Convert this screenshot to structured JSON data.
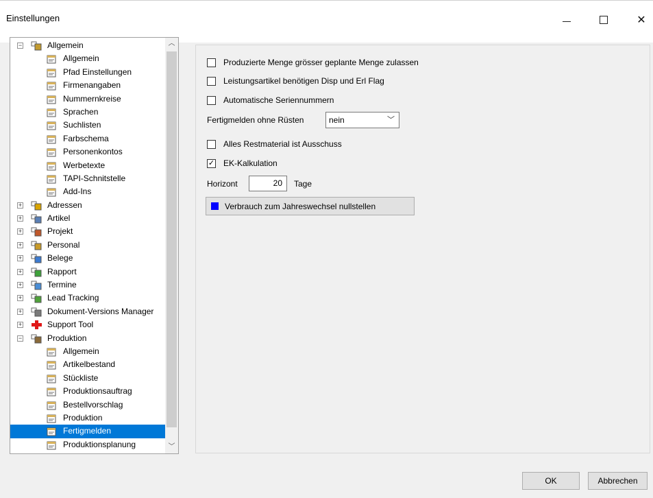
{
  "window": {
    "title": "Einstellungen",
    "minimize": "—",
    "close": "✕"
  },
  "tree": [
    {
      "label": "Allgemein",
      "level": 0,
      "expander": "−",
      "icon": "settings-folder-icon"
    },
    {
      "label": "Allgemein",
      "level": 1,
      "icon": "settings-page-icon"
    },
    {
      "label": "Pfad Einstellungen",
      "level": 1,
      "icon": "settings-page-icon"
    },
    {
      "label": "Firmenangaben",
      "level": 1,
      "icon": "settings-page-icon"
    },
    {
      "label": "Nummernkreise",
      "level": 1,
      "icon": "settings-page-icon"
    },
    {
      "label": "Sprachen",
      "level": 1,
      "icon": "settings-page-icon"
    },
    {
      "label": "Suchlisten",
      "level": 1,
      "icon": "settings-page-icon"
    },
    {
      "label": "Farbschema",
      "level": 1,
      "icon": "settings-page-icon"
    },
    {
      "label": "Personenkontos",
      "level": 1,
      "icon": "settings-page-icon"
    },
    {
      "label": "Werbetexte",
      "level": 1,
      "icon": "settings-page-icon"
    },
    {
      "label": "TAPI-Schnitstelle",
      "level": 1,
      "icon": "settings-page-icon"
    },
    {
      "label": "Add-Ins",
      "level": 1,
      "icon": "settings-page-icon"
    },
    {
      "label": "Adressen",
      "level": 0,
      "expander": "+",
      "icon": "addresses-icon"
    },
    {
      "label": "Artikel",
      "level": 0,
      "expander": "+",
      "icon": "article-icon"
    },
    {
      "label": "Projekt",
      "level": 0,
      "expander": "+",
      "icon": "project-icon"
    },
    {
      "label": "Personal",
      "level": 0,
      "expander": "+",
      "icon": "personnel-icon"
    },
    {
      "label": "Belege",
      "level": 0,
      "expander": "+",
      "icon": "documents-icon"
    },
    {
      "label": "Rapport",
      "level": 0,
      "expander": "+",
      "icon": "report-icon"
    },
    {
      "label": "Termine",
      "level": 0,
      "expander": "+",
      "icon": "calendar-icon"
    },
    {
      "label": "Lead Tracking",
      "level": 0,
      "expander": "+",
      "icon": "lead-tracking-icon"
    },
    {
      "label": "Dokument-Versions Manager",
      "level": 0,
      "expander": "+",
      "icon": "document-version-icon"
    },
    {
      "label": "Support Tool",
      "level": 0,
      "expander": "+",
      "icon": "support-cross-icon"
    },
    {
      "label": "Produktion",
      "level": 0,
      "expander": "−",
      "icon": "production-icon"
    },
    {
      "label": "Allgemein",
      "level": 1,
      "icon": "settings-page-icon"
    },
    {
      "label": "Artikelbestand",
      "level": 1,
      "icon": "settings-page-icon"
    },
    {
      "label": "Stückliste",
      "level": 1,
      "icon": "settings-page-icon"
    },
    {
      "label": "Produktionsauftrag",
      "level": 1,
      "icon": "settings-page-icon"
    },
    {
      "label": "Bestellvorschlag",
      "level": 1,
      "icon": "settings-page-icon"
    },
    {
      "label": "Produktion",
      "level": 1,
      "icon": "settings-page-icon"
    },
    {
      "label": "Fertigmelden",
      "level": 1,
      "icon": "settings-page-icon",
      "selected": true
    },
    {
      "label": "Produktionsplanung",
      "level": 1,
      "icon": "settings-page-icon"
    }
  ],
  "settings": {
    "produzierte_menge": {
      "label": "Produzierte Menge grösser geplante Menge zulassen",
      "checked": false
    },
    "leistungsartikel": {
      "label": "Leistungsartikel benötigen Disp und Erl Flag",
      "checked": false
    },
    "seriennummern": {
      "label": "Automatische Seriennummern",
      "checked": false
    },
    "fertigmelden_ohne_ruesten": {
      "label": "Fertigmelden ohne Rüsten",
      "value": "nein"
    },
    "restmaterial": {
      "label": "Alles Restmaterial ist Ausschuss",
      "checked": false
    },
    "ek_kalkulation": {
      "label": "EK-Kalkulation",
      "checked": true
    },
    "horizont": {
      "label": "Horizont",
      "value": "20",
      "unit": "Tage"
    },
    "verbrauch_button": {
      "label": "Verbrauch zum Jahreswechsel nullstellen",
      "swatch_color": "#0000ff"
    }
  },
  "footer": {
    "ok": "OK",
    "cancel": "Abbrechen"
  },
  "colors": {
    "selection": "#0078d7",
    "panel": "#f0f0f0"
  }
}
